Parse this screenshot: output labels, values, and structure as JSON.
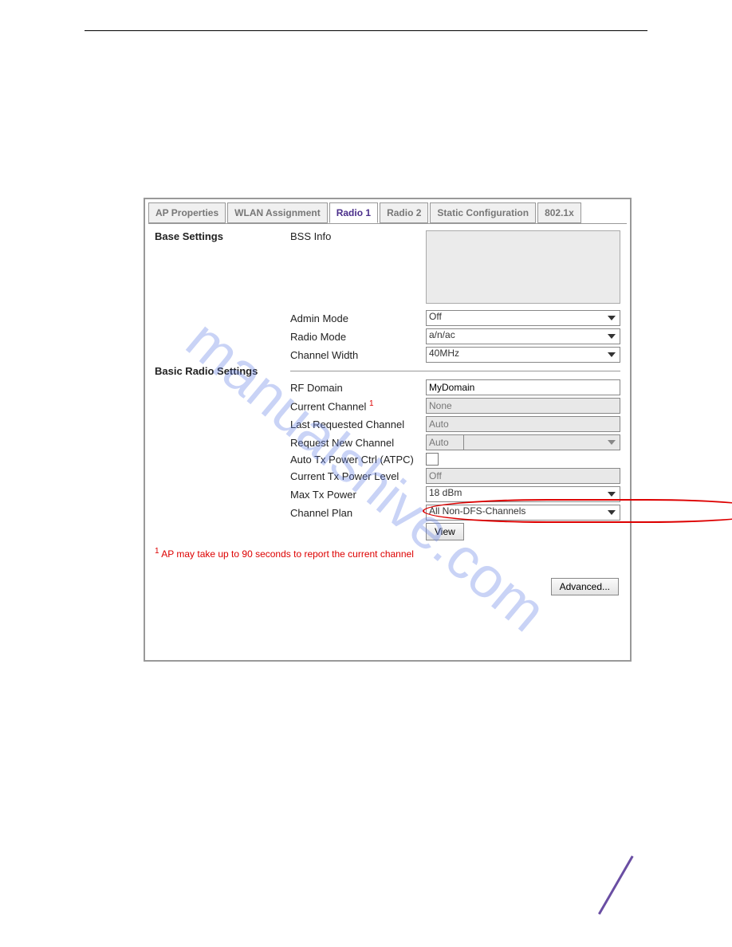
{
  "watermark": "manualshive.com",
  "tabs": {
    "ap_properties": "AP Properties",
    "wlan_assignment": "WLAN Assignment",
    "radio1": "Radio 1",
    "radio2": "Radio 2",
    "static_config": "Static Configuration",
    "8021x": "802.1x"
  },
  "sections": {
    "base": "Base Settings",
    "basic_radio": "Basic Radio Settings"
  },
  "labels": {
    "bss_info": "BSS Info",
    "admin_mode": "Admin Mode",
    "radio_mode": "Radio Mode",
    "channel_width": "Channel Width",
    "rf_domain": "RF Domain",
    "current_channel": "Current Channel",
    "last_requested_channel": "Last Requested Channel",
    "request_new_channel": "Request New Channel",
    "auto_tx_power": "Auto Tx Power Ctrl (ATPC)",
    "current_tx_power": "Current Tx Power Level",
    "max_tx_power": "Max Tx Power",
    "channel_plan": "Channel Plan"
  },
  "values": {
    "admin_mode": "Off",
    "radio_mode": "a/n/ac",
    "channel_width": "40MHz",
    "rf_domain": "MyDomain",
    "current_channel": "None",
    "last_requested_channel": "Auto",
    "request_new_channel": "Auto",
    "current_tx_power": "Off",
    "max_tx_power": "18 dBm",
    "channel_plan": "All Non-DFS-Channels"
  },
  "buttons": {
    "view": "View",
    "advanced": "Advanced..."
  },
  "footnote_sup": "1",
  "footnote": " AP may take up to 90 seconds to report the current channel"
}
